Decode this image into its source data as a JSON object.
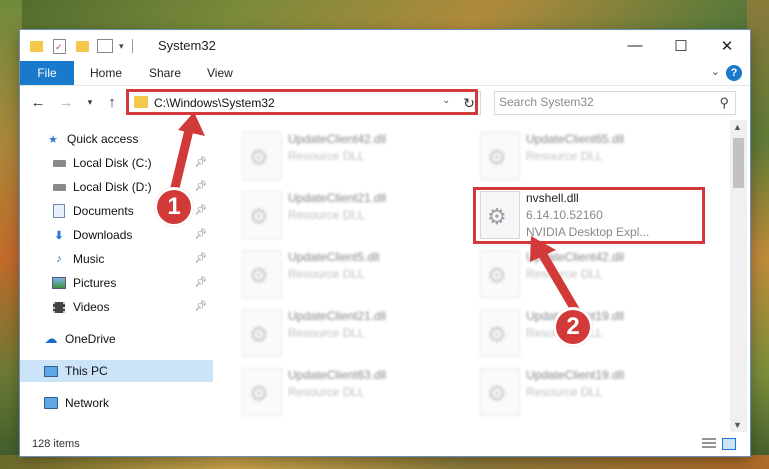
{
  "window": {
    "title": "System32",
    "controls": {
      "minimize": "—",
      "maximize": "☐",
      "close": "✕"
    }
  },
  "ribbon": {
    "tabs": [
      "File",
      "Home",
      "Share",
      "View"
    ],
    "help": "?"
  },
  "address_bar": {
    "path": "C:\\Windows\\System32",
    "search_placeholder": "Search System32"
  },
  "sidebar": {
    "items": [
      {
        "label": "Quick access",
        "icon": "star-icon",
        "pinned": false
      },
      {
        "label": "Local Disk (C:)",
        "icon": "drive-icon",
        "pinned": true
      },
      {
        "label": "Local Disk (D:)",
        "icon": "drive-icon",
        "pinned": true
      },
      {
        "label": "Documents",
        "icon": "documents-icon",
        "pinned": true
      },
      {
        "label": "Downloads",
        "icon": "download-icon",
        "pinned": true
      },
      {
        "label": "Music",
        "icon": "music-icon",
        "pinned": true
      },
      {
        "label": "Pictures",
        "icon": "pictures-icon",
        "pinned": true
      },
      {
        "label": "Videos",
        "icon": "videos-icon",
        "pinned": true
      },
      {
        "label": "OneDrive",
        "icon": "cloud-icon",
        "pinned": false
      },
      {
        "label": "This PC",
        "icon": "computer-icon",
        "pinned": false,
        "selected": true
      },
      {
        "label": "Network",
        "icon": "network-icon",
        "pinned": false
      }
    ]
  },
  "files": {
    "left": [
      {
        "name": "UpdateClient42.dll",
        "desc": "Resource DLL"
      },
      {
        "name": "UpdateClient21.dll",
        "desc": "Resource DLL"
      },
      {
        "name": "UpdateClient5.dll",
        "desc": "Resource DLL"
      },
      {
        "name": "UpdateClient21.dll",
        "desc": "Resource DLL"
      },
      {
        "name": "UpdateClient63.dll",
        "desc": "Resource DLL"
      }
    ],
    "right": [
      {
        "name": "UpdateClient65.dll",
        "desc": "Resource DLL"
      },
      {
        "name": "nvshell.dll",
        "desc": "6.14.10.52160",
        "desc2": "NVIDIA Desktop Expl..."
      },
      {
        "name": "UpdateClient42.dll",
        "desc": "Resource DLL"
      },
      {
        "name": "UpdateClient19.dll",
        "desc": "Resource DLL"
      },
      {
        "name": "UpdateClient19.dll",
        "desc": "Resource DLL"
      }
    ]
  },
  "status": {
    "item_count": "128 items"
  },
  "annotations": {
    "step1": "1",
    "step2": "2",
    "highlight_color": "#d23a3a"
  }
}
